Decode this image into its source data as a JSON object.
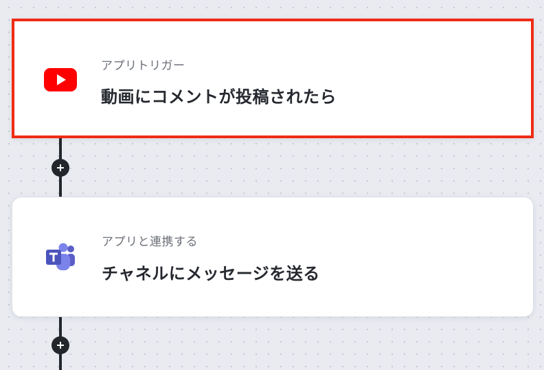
{
  "steps": [
    {
      "app": "youtube",
      "icon": "youtube-icon",
      "subtitle": "アプリトリガー",
      "title": "動画にコメントが投稿されたら",
      "selected": true,
      "accent": "#ef2c15"
    },
    {
      "app": "microsoft-teams",
      "icon": "teams-icon",
      "subtitle": "アプリと連携する",
      "title": "チャネルにメッセージを送る",
      "selected": false,
      "accent": "#5558af"
    }
  ],
  "add_step_icon": "plus-icon",
  "colors": {
    "canvas": "#e9ebf1",
    "connector": "#23262b",
    "highlight": "#ef2c15"
  }
}
